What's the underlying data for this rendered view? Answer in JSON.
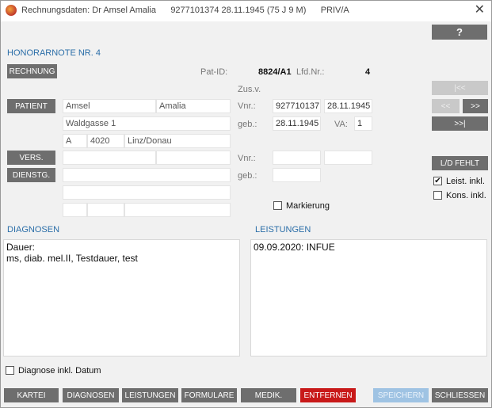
{
  "window": {
    "title": "Rechnungsdaten: Dr Amsel Amalia      9277101374 28.11.1945 (75 J 9 M)      PRIV/A",
    "close_glyph": "✕",
    "icon": "app-logo-icon"
  },
  "help_label": "?",
  "honorarnote_title": "HONORARNOTE NR. 4",
  "buttons": {
    "rechnung": "RECHNUNG",
    "patient": "PATIENT",
    "vers": "VERS.",
    "dienstg": "DIENSTG.",
    "first": "|<<",
    "prev": "<<",
    "next": ">>",
    "last": ">>|",
    "ld_fehlt": "L/D FEHLT"
  },
  "patient_info": {
    "pat_id_label": "Pat-ID:",
    "pat_id_value": "8824/A1",
    "lfd_nr_label": "Lfd.Nr.:",
    "lfd_nr_value": "4",
    "zusv_label": "Zus.v.",
    "vnr_label": "Vnr.:",
    "vnr_value": "927710137",
    "vnr_date": "28.11.1945",
    "geb_label": "geb.:",
    "geb_value": "28.11.1945",
    "va_label": "VA:",
    "va_value": "1",
    "surname": "Amsel",
    "firstname": "Amalia",
    "street": "Waldgasse 1",
    "country": "A",
    "zip": "4020",
    "city": "Linz/Donau"
  },
  "insured_info": {
    "vnr_label": "Vnr.:",
    "geb_label": "geb.:"
  },
  "checkboxes": {
    "markierung": {
      "label": "Markierung",
      "checked": false
    },
    "leist_inkl": {
      "label": "Leist. inkl.",
      "checked": true
    },
    "kons_inkl": {
      "label": "Kons. inkl.",
      "checked": false
    },
    "diagnose_inkl_datum": {
      "label": "Diagnose inkl. Datum",
      "checked": false
    }
  },
  "diagnosen": {
    "title": "DIAGNOSEN",
    "lines": [
      "Dauer:",
      "ms, diab. mel.II, Testdauer, test"
    ]
  },
  "leistungen": {
    "title": "LEISTUNGEN",
    "lines": [
      "09.09.2020: INFUE"
    ]
  },
  "bottom_buttons": {
    "kartei": "KARTEI",
    "diagnosen": "DIAGNOSEN",
    "leistungen": "LEISTUNGEN",
    "formulare": "FORMULARE",
    "medik": "MEDIK.",
    "entfernen": "ENTFERNEN",
    "speichern": "SPEICHERN",
    "schliessen": "SCHLIESSEN"
  },
  "colors": {
    "accent": "#2b6ea8",
    "button": "#6e6e6e",
    "danger": "#c81919",
    "disabled_blue": "#9fc3e3"
  }
}
